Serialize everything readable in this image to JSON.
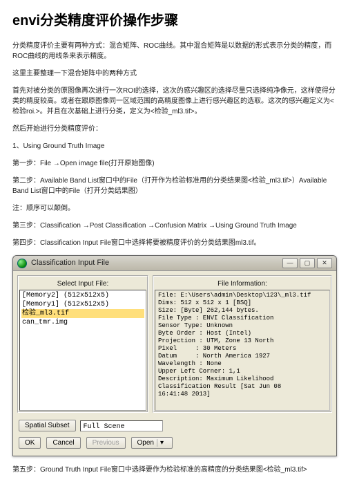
{
  "title": "envi分类精度评价操作步骤",
  "paras": {
    "p1": "分类精度评价主要有两种方式：混合矩阵、ROC曲线。其中混合矩阵是以数据的形式表示分类的精度，而ROC曲线的用线条来表示精度。",
    "p2": "这里主要整理一下混合矩阵中的两种方式",
    "p3": "首先对被分类的原图像再次进行一次ROI的选择，这次的感兴趣区的选择尽量只选择纯净像元，这样使得分类的精度较高。或者在跟原图像同一区域范围的高精度图像上进行感兴趣区的选取。这次的感兴趣定义为<检验roi.>。并且在次基础上进行分类，定义为<检验_ml3.tif>。",
    "p4": "然后开始进行分类精度评价：",
    "p5": "1、Using Ground Truth Image",
    "p6": "第一步：File →Open image file(打开原始图像)",
    "p7": "第二步：Available Band List窗口中的File（打开作为检验标准用的分类结果图<检验_ml3.tif>）Available Band List窗口中的File（打开分类结果图）",
    "p8": "注：顺序可以颠倒。",
    "p9": "第三步：Classification →Post Classification →Confusion Matrix →Using Ground Truth Image",
    "p10": "第四步：Classification Input File窗口中选择将要被精度评价的分类结果图ml3.tif。",
    "p11": "第五步：Ground Truth Input File窗口中选择要作为检验标准的高精度的分类结果图<检验_ml3.tif>"
  },
  "dialog": {
    "title": "Classification Input File",
    "leftHead": "Select Input File:",
    "rightHead": "File Information:",
    "items": {
      "i0": "[Memory2] (512x512x5)",
      "i1": "[Memory1] (512x512x5)",
      "i2": "检验_ml3.tif",
      "i3": "can_tmr.img"
    },
    "info": "File: E:\\Users\\admin\\Desktop\\123\\_ml3.tif\nDims: 512 x 512 x 1 [BSQ]\nSize: [Byte] 262,144 bytes.\nFile Type : ENVI Classification\nSensor Type: Unknown\nByte Order : Host (Intel)\nProjection : UTM, Zone 13 North\nPixel     : 30 Meters\nDatum     : North America 1927\nWavelength : None\nUpper Left Corner: 1,1\nDescription: Maximum Likelihood\nClassification Result [Sat Jun 08\n16:41:48 2013]",
    "spatialBtn": "Spatial Subset",
    "spatialVal": "Full Scene",
    "ok": "OK",
    "cancel": "Cancel",
    "previous": "Previous",
    "open": "Open",
    "arrow": "▾"
  }
}
